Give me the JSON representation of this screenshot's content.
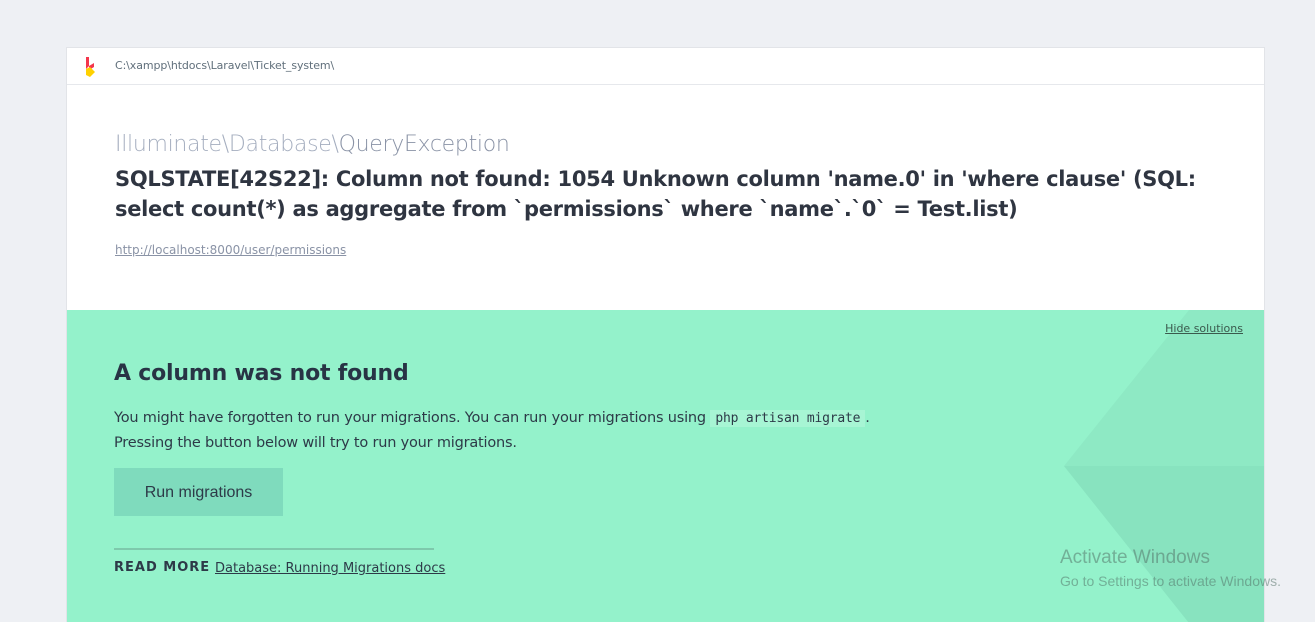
{
  "header": {
    "path": "C:\\xampp\\htdocs\\Laravel\\Ticket_system\\"
  },
  "exception": {
    "namespace": "Illuminate\\Database\\",
    "class": "QueryException",
    "message": "SQLSTATE[42S22]: Column not found: 1054 Unknown column 'name.0' in 'where clause' (SQL: select count(*) as aggregate from `permissions` where `name`.`0` = Test.list)",
    "url": "http://localhost:8000/user/permissions"
  },
  "solution": {
    "hide_label": "Hide solutions",
    "title": "A column was not found",
    "desc_part1": "You might have forgotten to run your migrations. You can run your migrations using ",
    "code": "php artisan migrate",
    "desc_part2": ".",
    "desc_line2": "Pressing the button below will try to run your migrations.",
    "button_label": "Run migrations",
    "read_more_label": "READ MORE",
    "read_more_link": "Database: Running Migrations docs"
  },
  "watermark": {
    "title": "Activate Windows",
    "subtitle": "Go to Settings to activate Windows."
  },
  "colors": {
    "page_bg": "#eef0f4",
    "solution_bg": "#94f2cb",
    "button_bg": "#7fdbbd",
    "logo_red": "#f4364c",
    "logo_yellow": "#ffd100"
  },
  "icons": {
    "logo": "ignition-logo-icon"
  }
}
